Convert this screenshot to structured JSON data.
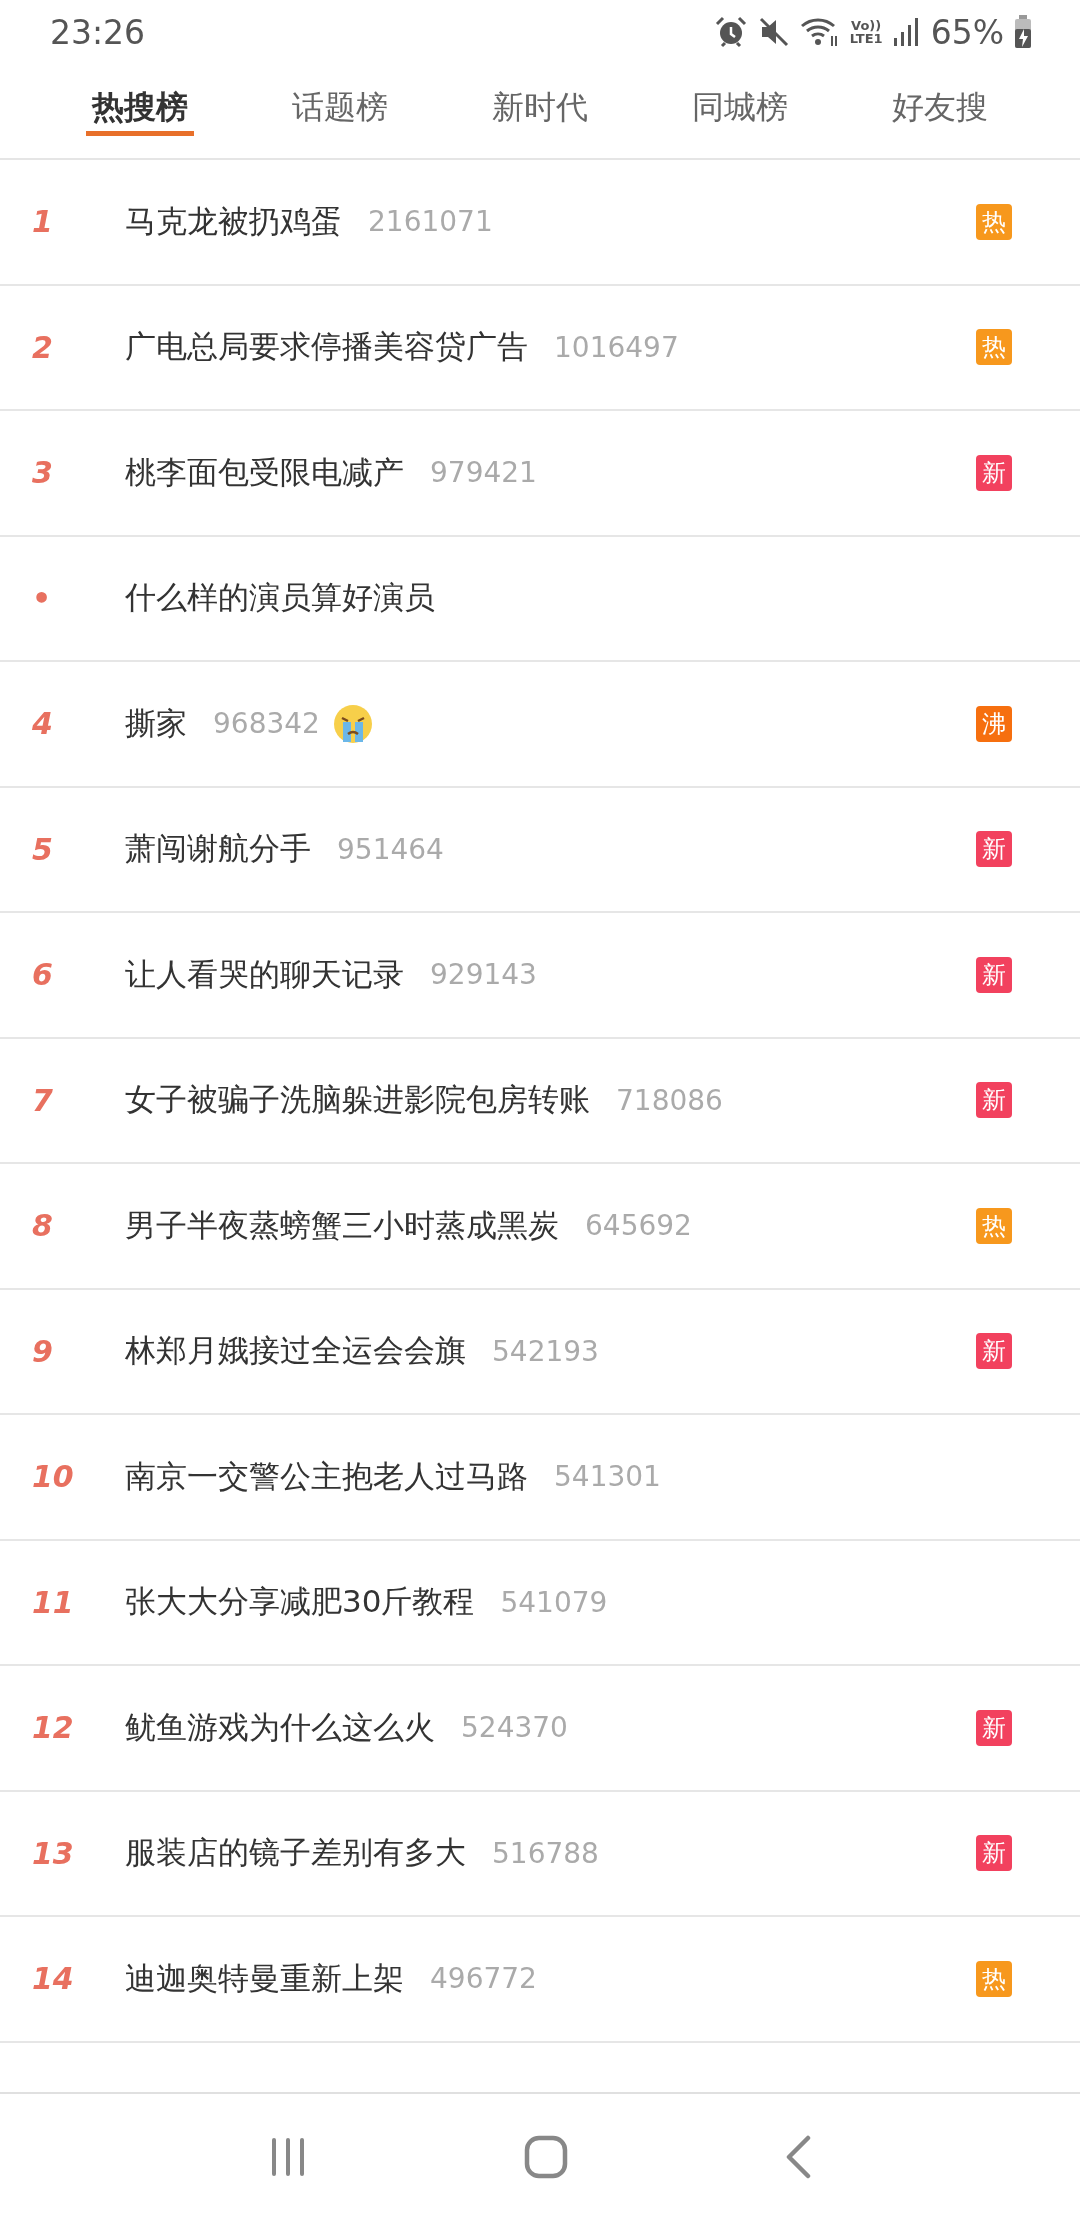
{
  "status_bar": {
    "time": "23:26",
    "volte_top": "Vo))",
    "volte_bottom": "LTE1",
    "battery": "65%"
  },
  "tabs": [
    {
      "label": "热搜榜",
      "selected": true
    },
    {
      "label": "话题榜",
      "selected": false
    },
    {
      "label": "新时代",
      "selected": false
    },
    {
      "label": "同城榜",
      "selected": false
    },
    {
      "label": "好友搜",
      "selected": false
    }
  ],
  "rows": [
    {
      "rank": "1",
      "title": "马克龙被扔鸡蛋",
      "count": "2161071",
      "emoji": false,
      "badge": {
        "label": "热",
        "color": "#f7981d"
      }
    },
    {
      "rank": "2",
      "title": "广电总局要求停播美容贷广告",
      "count": "1016497",
      "emoji": false,
      "badge": {
        "label": "热",
        "color": "#f7981d"
      }
    },
    {
      "rank": "3",
      "title": "桃李面包受限电减产",
      "count": "979421",
      "emoji": false,
      "badge": {
        "label": "新",
        "color": "#f2415e"
      }
    },
    {
      "rank": "•",
      "title": "什么样的演员算好演员",
      "emoji": false
    },
    {
      "rank": "4",
      "title": "撕家",
      "count": "968342",
      "emoji": true,
      "badge": {
        "label": "沸",
        "color": "#f66f0f"
      }
    },
    {
      "rank": "5",
      "title": "萧闯谢航分手",
      "count": "951464",
      "emoji": false,
      "badge": {
        "label": "新",
        "color": "#f2415e"
      }
    },
    {
      "rank": "6",
      "title": "让人看哭的聊天记录",
      "count": "929143",
      "emoji": false,
      "badge": {
        "label": "新",
        "color": "#f2415e"
      }
    },
    {
      "rank": "7",
      "title": "女子被骗子洗脑躲进影院包房转账",
      "count": "718086",
      "emoji": false,
      "badge": {
        "label": "新",
        "color": "#f2415e"
      }
    },
    {
      "rank": "8",
      "title": "男子半夜蒸螃蟹三小时蒸成黑炭",
      "count": "645692",
      "emoji": false,
      "badge": {
        "label": "热",
        "color": "#f7981d"
      }
    },
    {
      "rank": "9",
      "title": "林郑月娥接过全运会会旗",
      "count": "542193",
      "emoji": false,
      "badge": {
        "label": "新",
        "color": "#f2415e"
      }
    },
    {
      "rank": "10",
      "title": "南京一交警公主抱老人过马路",
      "count": "541301",
      "emoji": false
    },
    {
      "rank": "11",
      "title": "张大大分享减肥30斤教程",
      "count": "541079",
      "emoji": false
    },
    {
      "rank": "12",
      "title": "鱿鱼游戏为什么这么火",
      "count": "524370",
      "emoji": false,
      "badge": {
        "label": "新",
        "color": "#f2415e"
      }
    },
    {
      "rank": "13",
      "title": "服装店的镜子差别有多大",
      "count": "516788",
      "emoji": false,
      "badge": {
        "label": "新",
        "color": "#f2415e"
      }
    },
    {
      "rank": "14",
      "title": "迪迦奥特曼重新上架",
      "count": "496772",
      "emoji": false,
      "badge": {
        "label": "热",
        "color": "#f7981d"
      }
    }
  ]
}
